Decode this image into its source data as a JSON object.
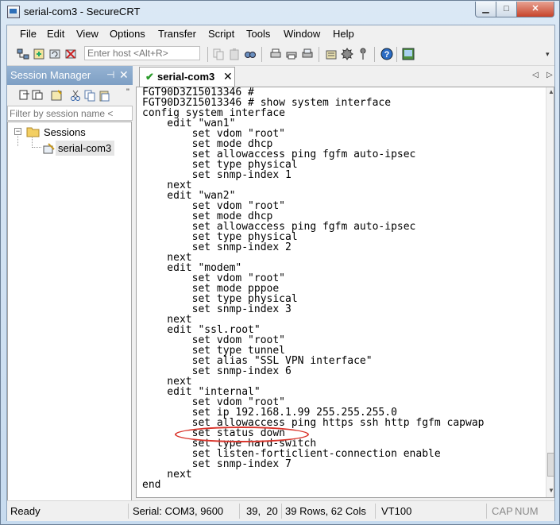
{
  "window": {
    "title": "serial-com3 - SecureCRT"
  },
  "menu": [
    "File",
    "Edit",
    "View",
    "Options",
    "Transfer",
    "Script",
    "Tools",
    "Window",
    "Help"
  ],
  "toolbar": {
    "host_placeholder": "Enter host <Alt+R>"
  },
  "session_manager": {
    "title": "Session Manager",
    "filter_placeholder": "Filter by session name <",
    "tree": {
      "root": "Sessions",
      "child": "serial-com3"
    }
  },
  "tab": {
    "label": "serial-com3"
  },
  "terminal": {
    "lines": [
      "FGT90D3Z15013346 #",
      "FGT90D3Z15013346 # show system interface",
      "config system interface",
      "    edit \"wan1\"",
      "        set vdom \"root\"",
      "        set mode dhcp",
      "        set allowaccess ping fgfm auto-ipsec",
      "        set type physical",
      "        set snmp-index 1",
      "    next",
      "    edit \"wan2\"",
      "        set vdom \"root\"",
      "        set mode dhcp",
      "        set allowaccess ping fgfm auto-ipsec",
      "        set type physical",
      "        set snmp-index 2",
      "    next",
      "    edit \"modem\"",
      "        set vdom \"root\"",
      "        set mode pppoe",
      "        set type physical",
      "        set snmp-index 3",
      "    next",
      "    edit \"ssl.root\"",
      "        set vdom \"root\"",
      "        set type tunnel",
      "        set alias \"SSL VPN interface\"",
      "        set snmp-index 6",
      "    next",
      "    edit \"internal\"",
      "        set vdom \"root\"",
      "        set ip 192.168.1.99 255.255.255.0",
      "        set allowaccess ping https ssh http fgfm capwap",
      "        set status down",
      "        set type hard-switch",
      "        set listen-forticlient-connection enable",
      "        set snmp-index 7",
      "    next",
      "end"
    ]
  },
  "status": {
    "ready": "Ready",
    "serial": "Serial: COM3, 9600",
    "cursor": "39,  20",
    "size": "39 Rows, 62 Cols",
    "term": "VT100",
    "cap": "CAP",
    "num": "NUM"
  },
  "colors": {
    "annotation": "#d9342b",
    "tab_check": "#2a9a2a"
  }
}
